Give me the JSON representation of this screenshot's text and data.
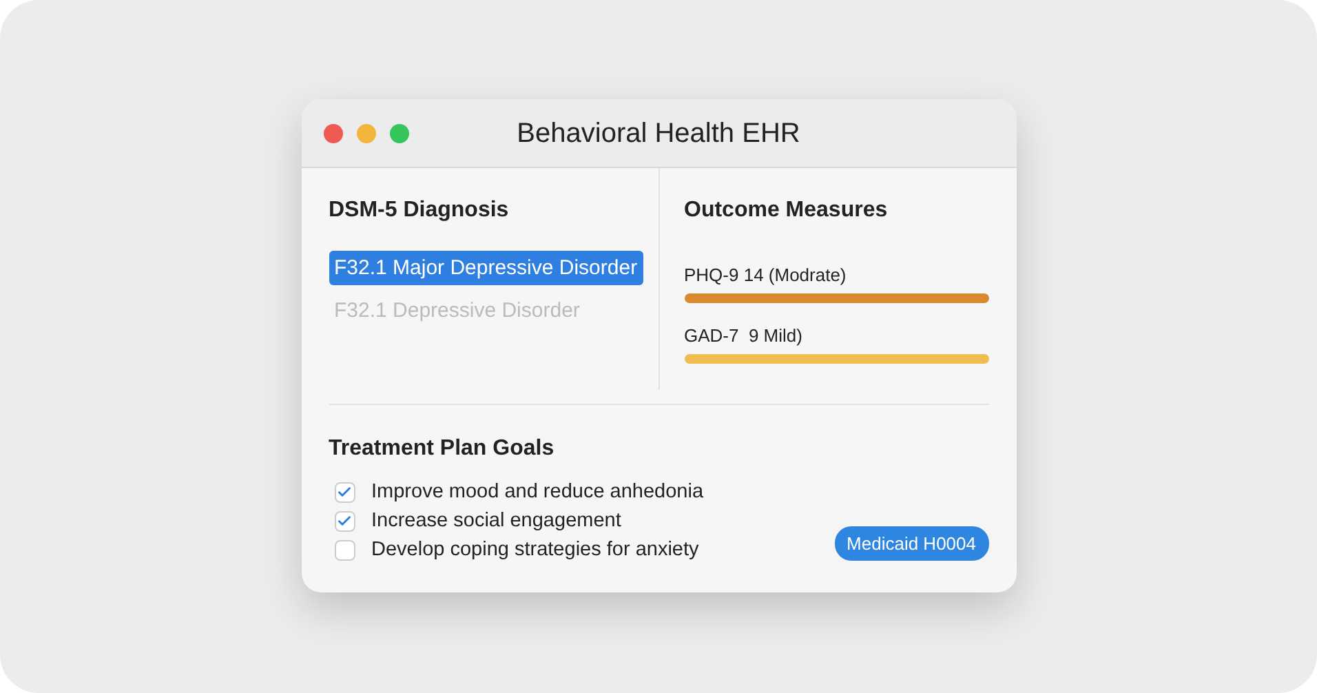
{
  "window": {
    "title": "Behavioral Health EHR"
  },
  "diagnosis": {
    "title": "DSM-5 Diagnosis",
    "items": [
      {
        "label": "F32.1 Major Depressive Disorder",
        "selected": true
      },
      {
        "label": "F32.1 Depressive Disorder",
        "selected": false
      }
    ]
  },
  "outcome_measures": {
    "title": "Outcome Measures",
    "items": [
      {
        "label": "PHQ-9 14 (Modrate)",
        "color": "#d98a30"
      },
      {
        "label": "GAD-7  9 Mild)",
        "color": "#f0bd4f"
      }
    ]
  },
  "treatment_plan": {
    "title": "Treatment Plan Goals",
    "goals": [
      {
        "label": "Improve mood and reduce anhedonia",
        "checked": true
      },
      {
        "label": "Increase social engagement",
        "checked": true
      },
      {
        "label": "Develop coping strategies for anxiety",
        "checked": false
      }
    ]
  },
  "badge": "Medicaid H0004"
}
